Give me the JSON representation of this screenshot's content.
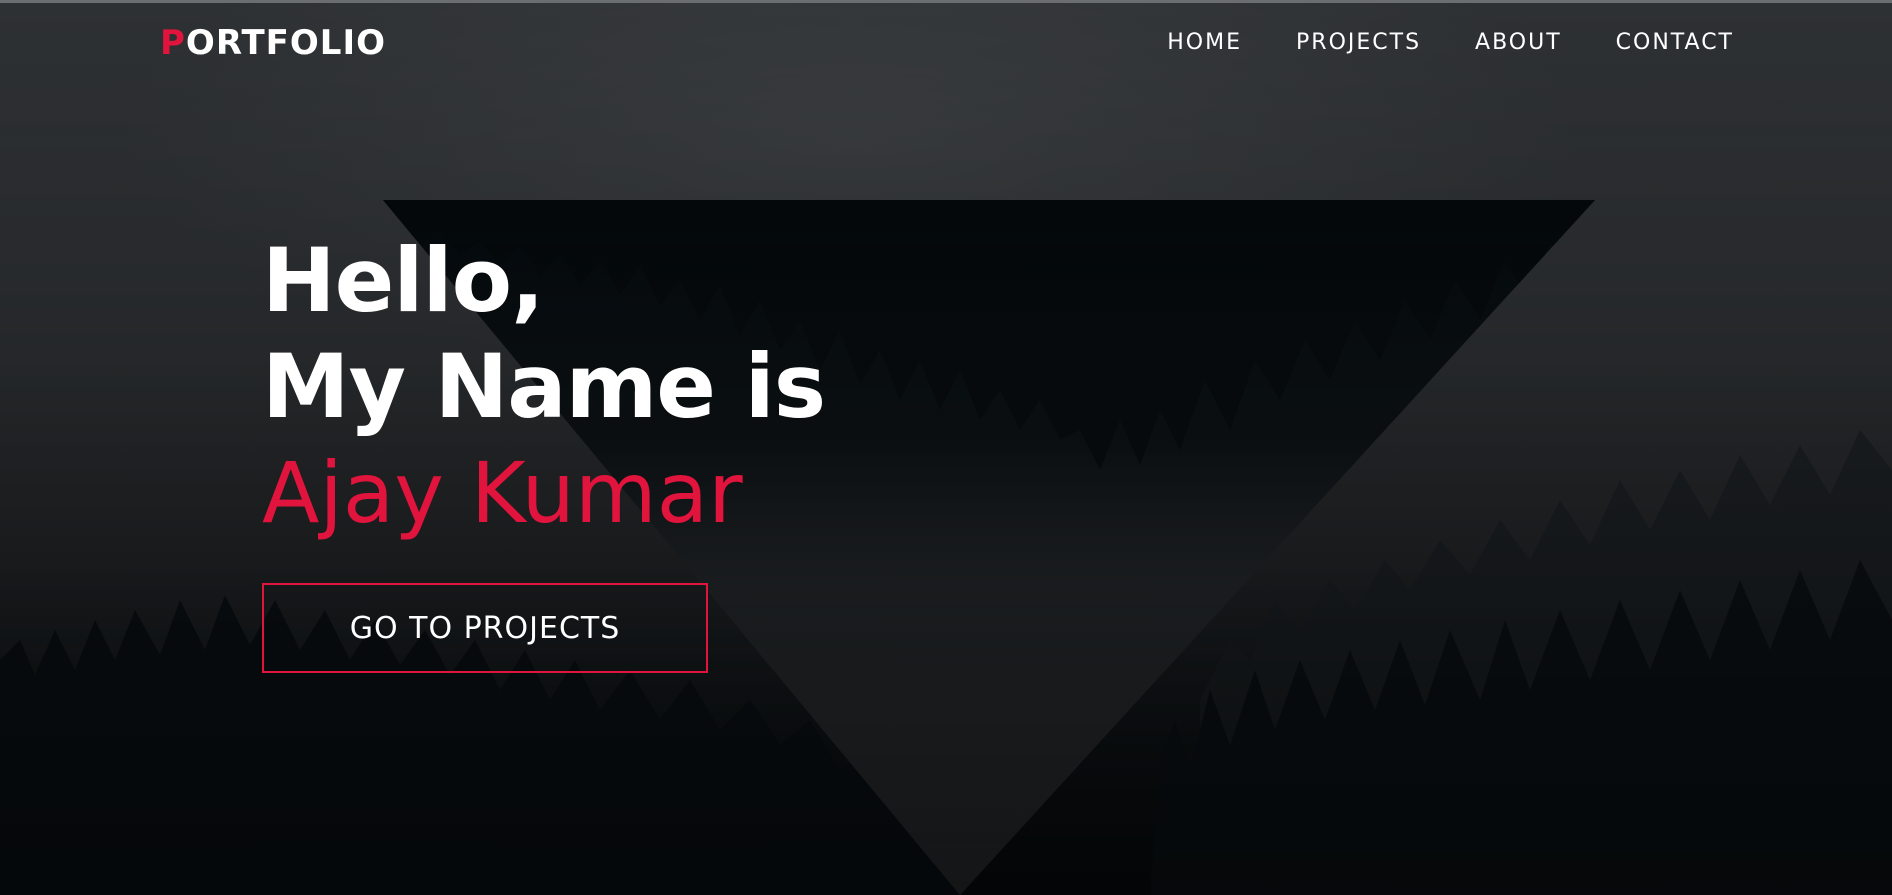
{
  "header": {
    "logo_first_letter": "P",
    "logo_rest": "ORTFOLIO",
    "nav": [
      {
        "label": "HOME"
      },
      {
        "label": "PROJECTS"
      },
      {
        "label": "ABOUT"
      },
      {
        "label": "CONTACT"
      }
    ]
  },
  "hero": {
    "greeting": "Hello,",
    "intro": "My Name is",
    "name": "Ajay Kumar",
    "cta_label": "GO TO PROJECTS"
  },
  "colors": {
    "accent": "#e0143c",
    "text": "#ffffff",
    "background": "#2b2e31",
    "forest": "#02080c"
  },
  "visuals": {
    "background": "foggy-pine-forest",
    "shape": "inverted-triangle"
  }
}
